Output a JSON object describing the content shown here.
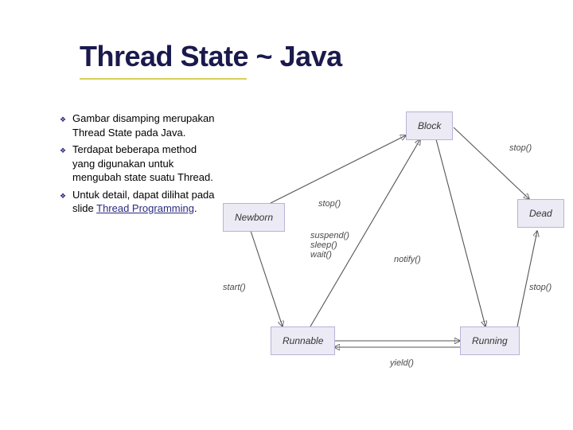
{
  "title": "Thread State ~ Java",
  "bullets": [
    {
      "text": "Gambar disamping merupakan Thread State pada Java."
    },
    {
      "text": "Terdapat beberapa method yang digunakan untuk mengubah state suatu Thread."
    },
    {
      "text_prefix": "Untuk detail, dapat dilihat pada slide ",
      "link": "Thread Programming",
      "text_suffix": "."
    }
  ],
  "diagram": {
    "states": {
      "newborn": "Newborn",
      "block": "Block",
      "dead": "Dead",
      "runnable": "Runnable",
      "running": "Running"
    },
    "edge_labels": {
      "stop1": "stop()",
      "stop2": "stop()",
      "stop3": "stop()",
      "start": "start()",
      "suspend_sleep_wait": "suspend()\nsleep()\nwait()",
      "notify": "notify()",
      "yield": "yield()"
    }
  }
}
